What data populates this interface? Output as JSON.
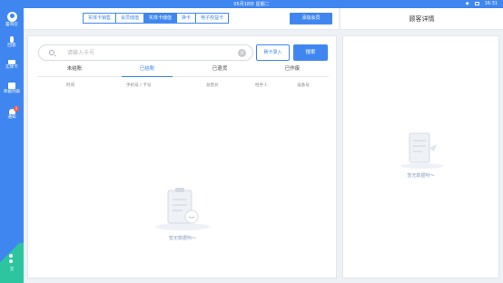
{
  "statusbar": {
    "date": "05月18日 星期二",
    "time": "16:31"
  },
  "sidebar": {
    "items": [
      {
        "label": "蕾哥云",
        "icon": "avatar-icon"
      },
      {
        "label": "回客",
        "icon": "people-icon"
      },
      {
        "label": "实体卡",
        "icon": "card-icon"
      },
      {
        "label": "单据列表",
        "icon": "list-icon"
      },
      {
        "label": "通知",
        "icon": "bell-icon",
        "badge": "1"
      }
    ],
    "bottom_label": "交"
  },
  "topbar": {
    "tabs": [
      {
        "label": "实体卡销售",
        "active": false
      },
      {
        "label": "会员储值",
        "active": false
      },
      {
        "label": "实体卡储值",
        "active": true
      },
      {
        "label": "换卡",
        "active": false
      },
      {
        "label": "电子权益卡",
        "active": false
      }
    ],
    "add_member_label": "添加会员"
  },
  "right_header": {
    "title": "顾客详情"
  },
  "search": {
    "placeholder": "请输入卡号",
    "value": "",
    "card_entry_label": "刷卡录入",
    "search_label": "搜索"
  },
  "status_tabs": [
    {
      "label": "未结账",
      "active": false
    },
    {
      "label": "已结账",
      "active": true
    },
    {
      "label": "已退货",
      "active": false
    },
    {
      "label": "已作废",
      "active": false
    }
  ],
  "table": {
    "columns": [
      "时间",
      "手机号 / 卡号",
      "总售价",
      "经手人",
      "设备号"
    ]
  },
  "empty_left": {
    "label": "暂无数据哟～"
  },
  "empty_right": {
    "label": "暂无数据哟～"
  },
  "colors": {
    "accent": "#3f86f0",
    "teal": "#2cc5a0",
    "badge": "#f45a4a"
  }
}
